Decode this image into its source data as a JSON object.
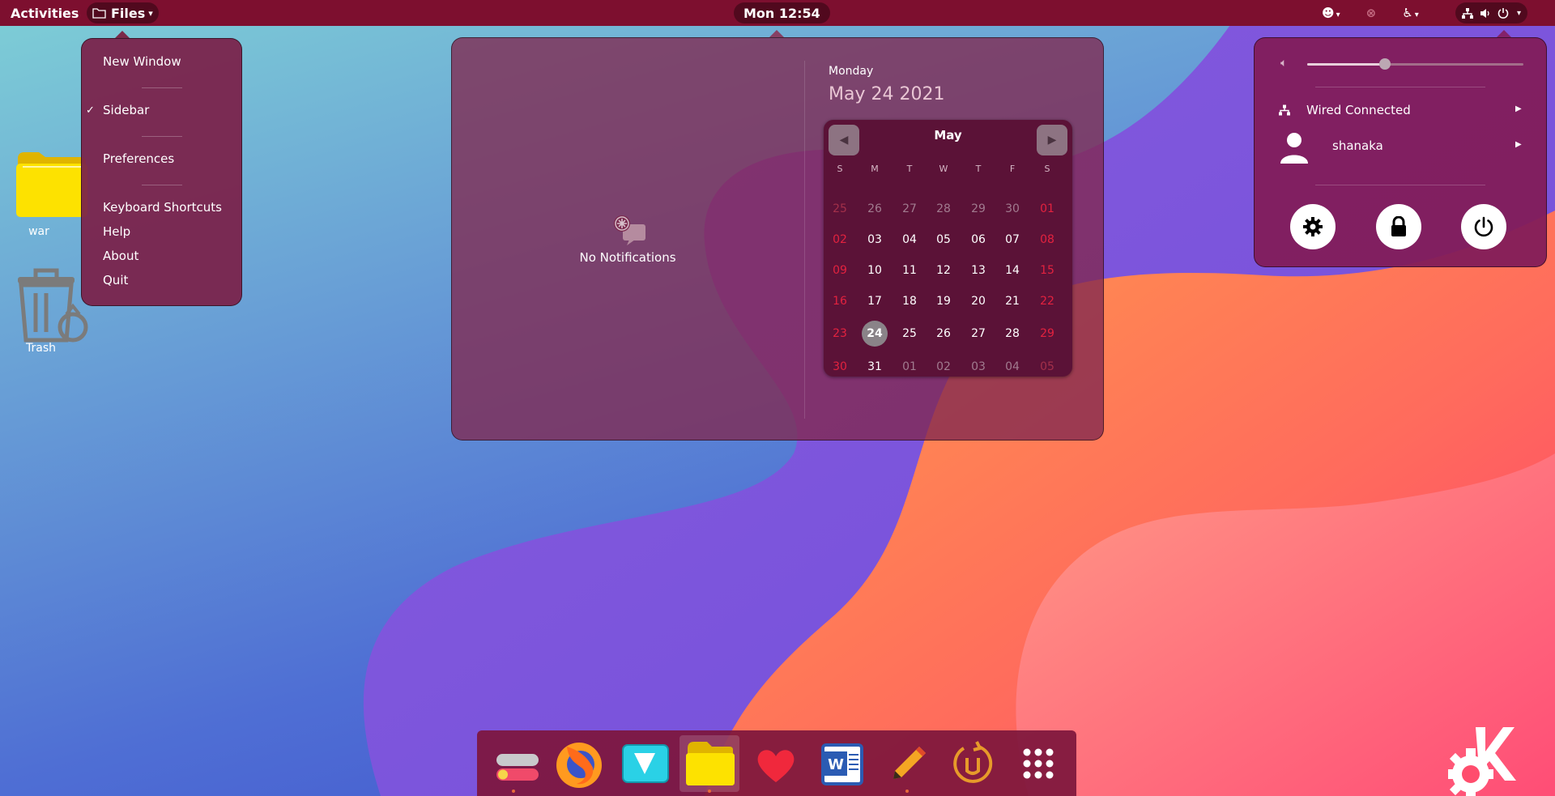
{
  "topbar": {
    "activities": "Activities",
    "app_menu_label": "Files",
    "clock": "Mon 12:54"
  },
  "files_menu": {
    "items": [
      {
        "label": "New Window"
      },
      {
        "label": "Sidebar",
        "checked": true
      },
      {
        "label": "Preferences"
      },
      {
        "label": "Keyboard Shortcuts"
      },
      {
        "label": "Help"
      },
      {
        "label": "About"
      },
      {
        "label": "Quit"
      }
    ]
  },
  "notifications": {
    "empty_text": "No Notifications"
  },
  "calendar": {
    "day_name": "Monday",
    "date_full": "May 24 2021",
    "month": "May",
    "weekdays": [
      "S",
      "M",
      "T",
      "W",
      "T",
      "F",
      "S"
    ],
    "weeks": [
      [
        "25",
        "26",
        "27",
        "28",
        "29",
        "30",
        "01"
      ],
      [
        "02",
        "03",
        "04",
        "05",
        "06",
        "07",
        "08"
      ],
      [
        "09",
        "10",
        "11",
        "12",
        "13",
        "14",
        "15"
      ],
      [
        "16",
        "17",
        "18",
        "19",
        "20",
        "21",
        "22"
      ],
      [
        "23",
        "24",
        "25",
        "26",
        "27",
        "28",
        "29"
      ],
      [
        "30",
        "31",
        "01",
        "02",
        "03",
        "04",
        "05"
      ]
    ],
    "today": "24"
  },
  "system_menu": {
    "volume_level": 0.36,
    "network_label": "Wired Connected",
    "user_label": "shanaka"
  },
  "desktop": {
    "icons": [
      {
        "label": "war"
      },
      {
        "label": "Trash"
      }
    ]
  },
  "dock": {
    "apps": [
      {
        "icon": "todo-app-icon",
        "running": true
      },
      {
        "icon": "firefox-icon",
        "running": false
      },
      {
        "icon": "vector-app-icon",
        "running": false
      },
      {
        "icon": "files-icon",
        "running": true,
        "active": true
      },
      {
        "icon": "heart-app-icon",
        "running": false
      },
      {
        "icon": "word-icon",
        "running": false
      },
      {
        "icon": "pencil-app-icon",
        "running": true
      },
      {
        "icon": "timeshift-icon",
        "running": false
      },
      {
        "icon": "app-grid-icon",
        "running": false
      }
    ]
  },
  "colors": {
    "topbar": "#7d0f2f",
    "accent": "#e3223f"
  }
}
